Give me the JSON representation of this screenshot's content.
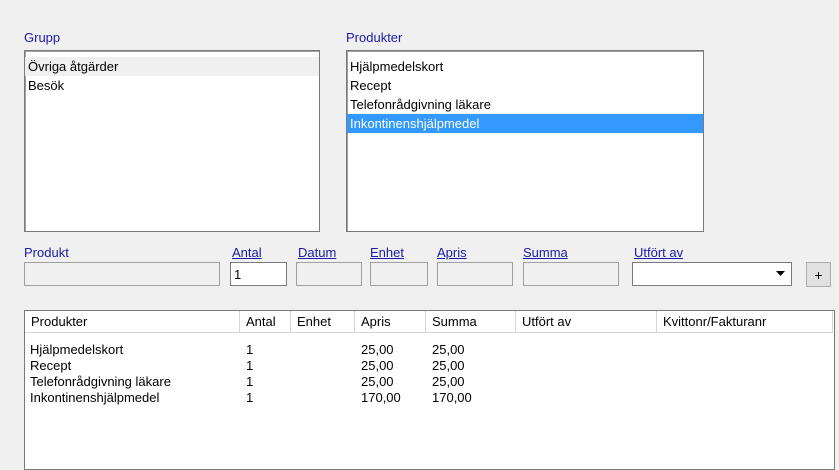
{
  "labels": {
    "grupp": "Grupp",
    "produkter": "Produkter",
    "produkt": "Produkt",
    "antal": "Antal",
    "datum": "Datum",
    "enhet": "Enhet",
    "apris": "Apris",
    "summa": "Summa",
    "utfort_av": "Utfört av"
  },
  "grupp_list": [
    "Övriga åtgärder",
    "Besök"
  ],
  "produkter_list": [
    "Hjälpmedelskort",
    "Recept",
    "Telefonrådgivning läkare",
    "Inkontinenshjälpmedel"
  ],
  "selected_produkt_index": 3,
  "fields": {
    "produkt": "",
    "antal": "1",
    "datum": "",
    "enhet": "",
    "apris": "",
    "summa": "",
    "utfort_av": ""
  },
  "add_button": "+",
  "table": {
    "columns": [
      "Produkter",
      "Antal",
      "Enhet",
      "Apris",
      "Summa",
      "Utfört av",
      "Kvittonr/Fakturanr"
    ],
    "rows": [
      [
        "Hjälpmedelskort",
        "1",
        "",
        "25,00",
        "25,00",
        "",
        ""
      ],
      [
        "Recept",
        "1",
        "",
        "25,00",
        "25,00",
        "",
        ""
      ],
      [
        "Telefonrådgivning läkare",
        "1",
        "",
        "25,00",
        "25,00",
        "",
        ""
      ],
      [
        "Inkontinenshjälpmedel",
        "1",
        "",
        "170,00",
        "170,00",
        "",
        ""
      ]
    ]
  },
  "icons": {
    "dropdown": "chevron-down-icon"
  }
}
